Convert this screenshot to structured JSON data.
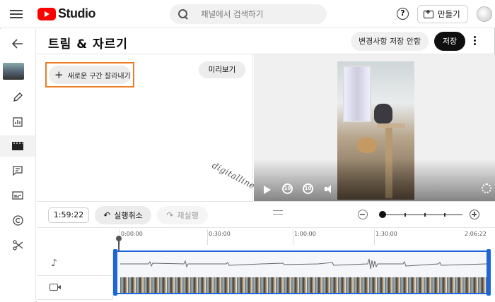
{
  "topbar": {
    "app_name": "Studio",
    "search_placeholder": "채널에서 검색하기",
    "help_label": "?",
    "create_label": "만들기"
  },
  "sidebar": {
    "items": [
      "back-icon",
      "video-thumbnail",
      "edit-icon",
      "analytics-icon",
      "editor-icon",
      "comments-icon",
      "subtitles-icon",
      "copyright-icon",
      "audio-library-icon"
    ]
  },
  "header": {
    "title": "트림 & 자르기",
    "discard_label": "변경사항 저장 안함",
    "save_label": "저장"
  },
  "editor": {
    "new_cut_label": "새로운 구간 잘라내기",
    "preview_label": "미리보기",
    "watermark": "digitalline"
  },
  "toolbar": {
    "timecode": "1:59:22",
    "undo_label": "실행취소",
    "redo_label": "재실행"
  },
  "player": {
    "rewind_label": "10",
    "forward_label": "10"
  },
  "timeline": {
    "ticks": [
      "0:00:00",
      "0:30:00",
      "1:00:00",
      "1:30:00",
      "2:06:22"
    ]
  },
  "colors": {
    "accent": "#1e66d6",
    "highlight_box": "#ee7d23",
    "brand_red": "#ff0000"
  }
}
